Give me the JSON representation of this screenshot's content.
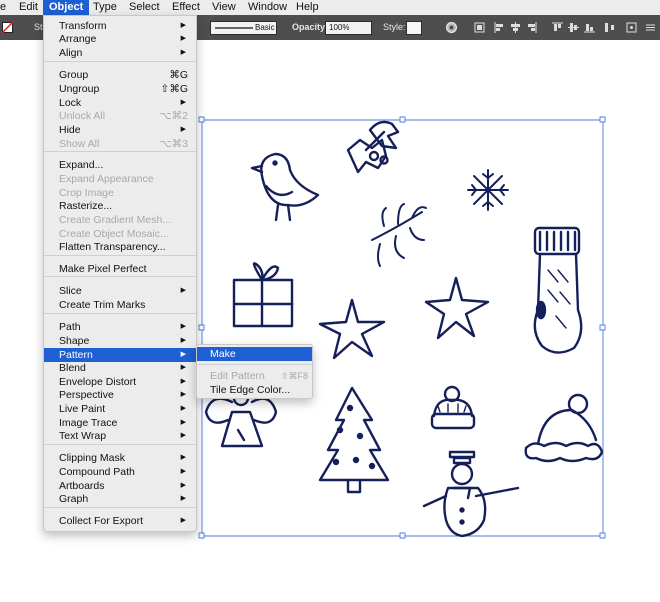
{
  "menubar": {
    "items": [
      "e",
      "Edit",
      "Object",
      "Type",
      "Select",
      "Effect",
      "View",
      "Window",
      "Help"
    ]
  },
  "controlbar": {
    "stroke_label": "St",
    "brush_label": "Basic",
    "opacity_label": "Opacity:",
    "opacity_value": "100%",
    "style_label": "Style:"
  },
  "object_menu": {
    "items": [
      {
        "label": "Transform",
        "shortcut": "",
        "submenu": true,
        "enabled": true
      },
      {
        "label": "Arrange",
        "shortcut": "",
        "submenu": true,
        "enabled": true
      },
      {
        "label": "Align",
        "shortcut": "",
        "submenu": true,
        "enabled": true
      },
      {
        "label": "Group",
        "shortcut": "⌘G",
        "submenu": false,
        "enabled": true
      },
      {
        "label": "Ungroup",
        "shortcut": "⇧⌘G",
        "submenu": false,
        "enabled": true
      },
      {
        "label": "Lock",
        "shortcut": "",
        "submenu": true,
        "enabled": true
      },
      {
        "label": "Unlock All",
        "shortcut": "⌥⌘2",
        "submenu": false,
        "enabled": false
      },
      {
        "label": "Hide",
        "shortcut": "",
        "submenu": true,
        "enabled": true
      },
      {
        "label": "Show All",
        "shortcut": "⌥⌘3",
        "submenu": false,
        "enabled": false
      },
      {
        "label": "Expand...",
        "shortcut": "",
        "submenu": false,
        "enabled": true
      },
      {
        "label": "Expand Appearance",
        "shortcut": "",
        "submenu": false,
        "enabled": false
      },
      {
        "label": "Crop Image",
        "shortcut": "",
        "submenu": false,
        "enabled": false
      },
      {
        "label": "Rasterize...",
        "shortcut": "",
        "submenu": false,
        "enabled": true
      },
      {
        "label": "Create Gradient Mesh...",
        "shortcut": "",
        "submenu": false,
        "enabled": false
      },
      {
        "label": "Create Object Mosaic...",
        "shortcut": "",
        "submenu": false,
        "enabled": false
      },
      {
        "label": "Flatten Transparency...",
        "shortcut": "",
        "submenu": false,
        "enabled": true
      },
      {
        "label": "Make Pixel Perfect",
        "shortcut": "",
        "submenu": false,
        "enabled": true
      },
      {
        "label": "Slice",
        "shortcut": "",
        "submenu": true,
        "enabled": true
      },
      {
        "label": "Create Trim Marks",
        "shortcut": "",
        "submenu": false,
        "enabled": true
      },
      {
        "label": "Path",
        "shortcut": "",
        "submenu": true,
        "enabled": true
      },
      {
        "label": "Shape",
        "shortcut": "",
        "submenu": true,
        "enabled": true
      },
      {
        "label": "Pattern",
        "shortcut": "",
        "submenu": true,
        "enabled": true,
        "highlighted": true
      },
      {
        "label": "Blend",
        "shortcut": "",
        "submenu": true,
        "enabled": true
      },
      {
        "label": "Envelope Distort",
        "shortcut": "",
        "submenu": true,
        "enabled": true
      },
      {
        "label": "Perspective",
        "shortcut": "",
        "submenu": true,
        "enabled": true
      },
      {
        "label": "Live Paint",
        "shortcut": "",
        "submenu": true,
        "enabled": true
      },
      {
        "label": "Image Trace",
        "shortcut": "",
        "submenu": true,
        "enabled": true
      },
      {
        "label": "Text Wrap",
        "shortcut": "",
        "submenu": true,
        "enabled": true
      },
      {
        "label": "Clipping Mask",
        "shortcut": "",
        "submenu": true,
        "enabled": true
      },
      {
        "label": "Compound Path",
        "shortcut": "",
        "submenu": true,
        "enabled": true
      },
      {
        "label": "Artboards",
        "shortcut": "",
        "submenu": true,
        "enabled": true
      },
      {
        "label": "Graph",
        "shortcut": "",
        "submenu": true,
        "enabled": true
      },
      {
        "label": "Collect For Export",
        "shortcut": "",
        "submenu": true,
        "enabled": true
      }
    ]
  },
  "pattern_submenu": {
    "items": [
      {
        "label": "Make",
        "shortcut": "",
        "enabled": true,
        "highlighted": true
      },
      {
        "label": "Edit Pattern",
        "shortcut": "⇧⌘F8",
        "enabled": false
      },
      {
        "label": "Tile Edge Color...",
        "shortcut": "",
        "enabled": true
      }
    ]
  },
  "colors": {
    "accent": "#1e5fd3",
    "selection": "#4a78e0",
    "artwork": "#15205a"
  }
}
